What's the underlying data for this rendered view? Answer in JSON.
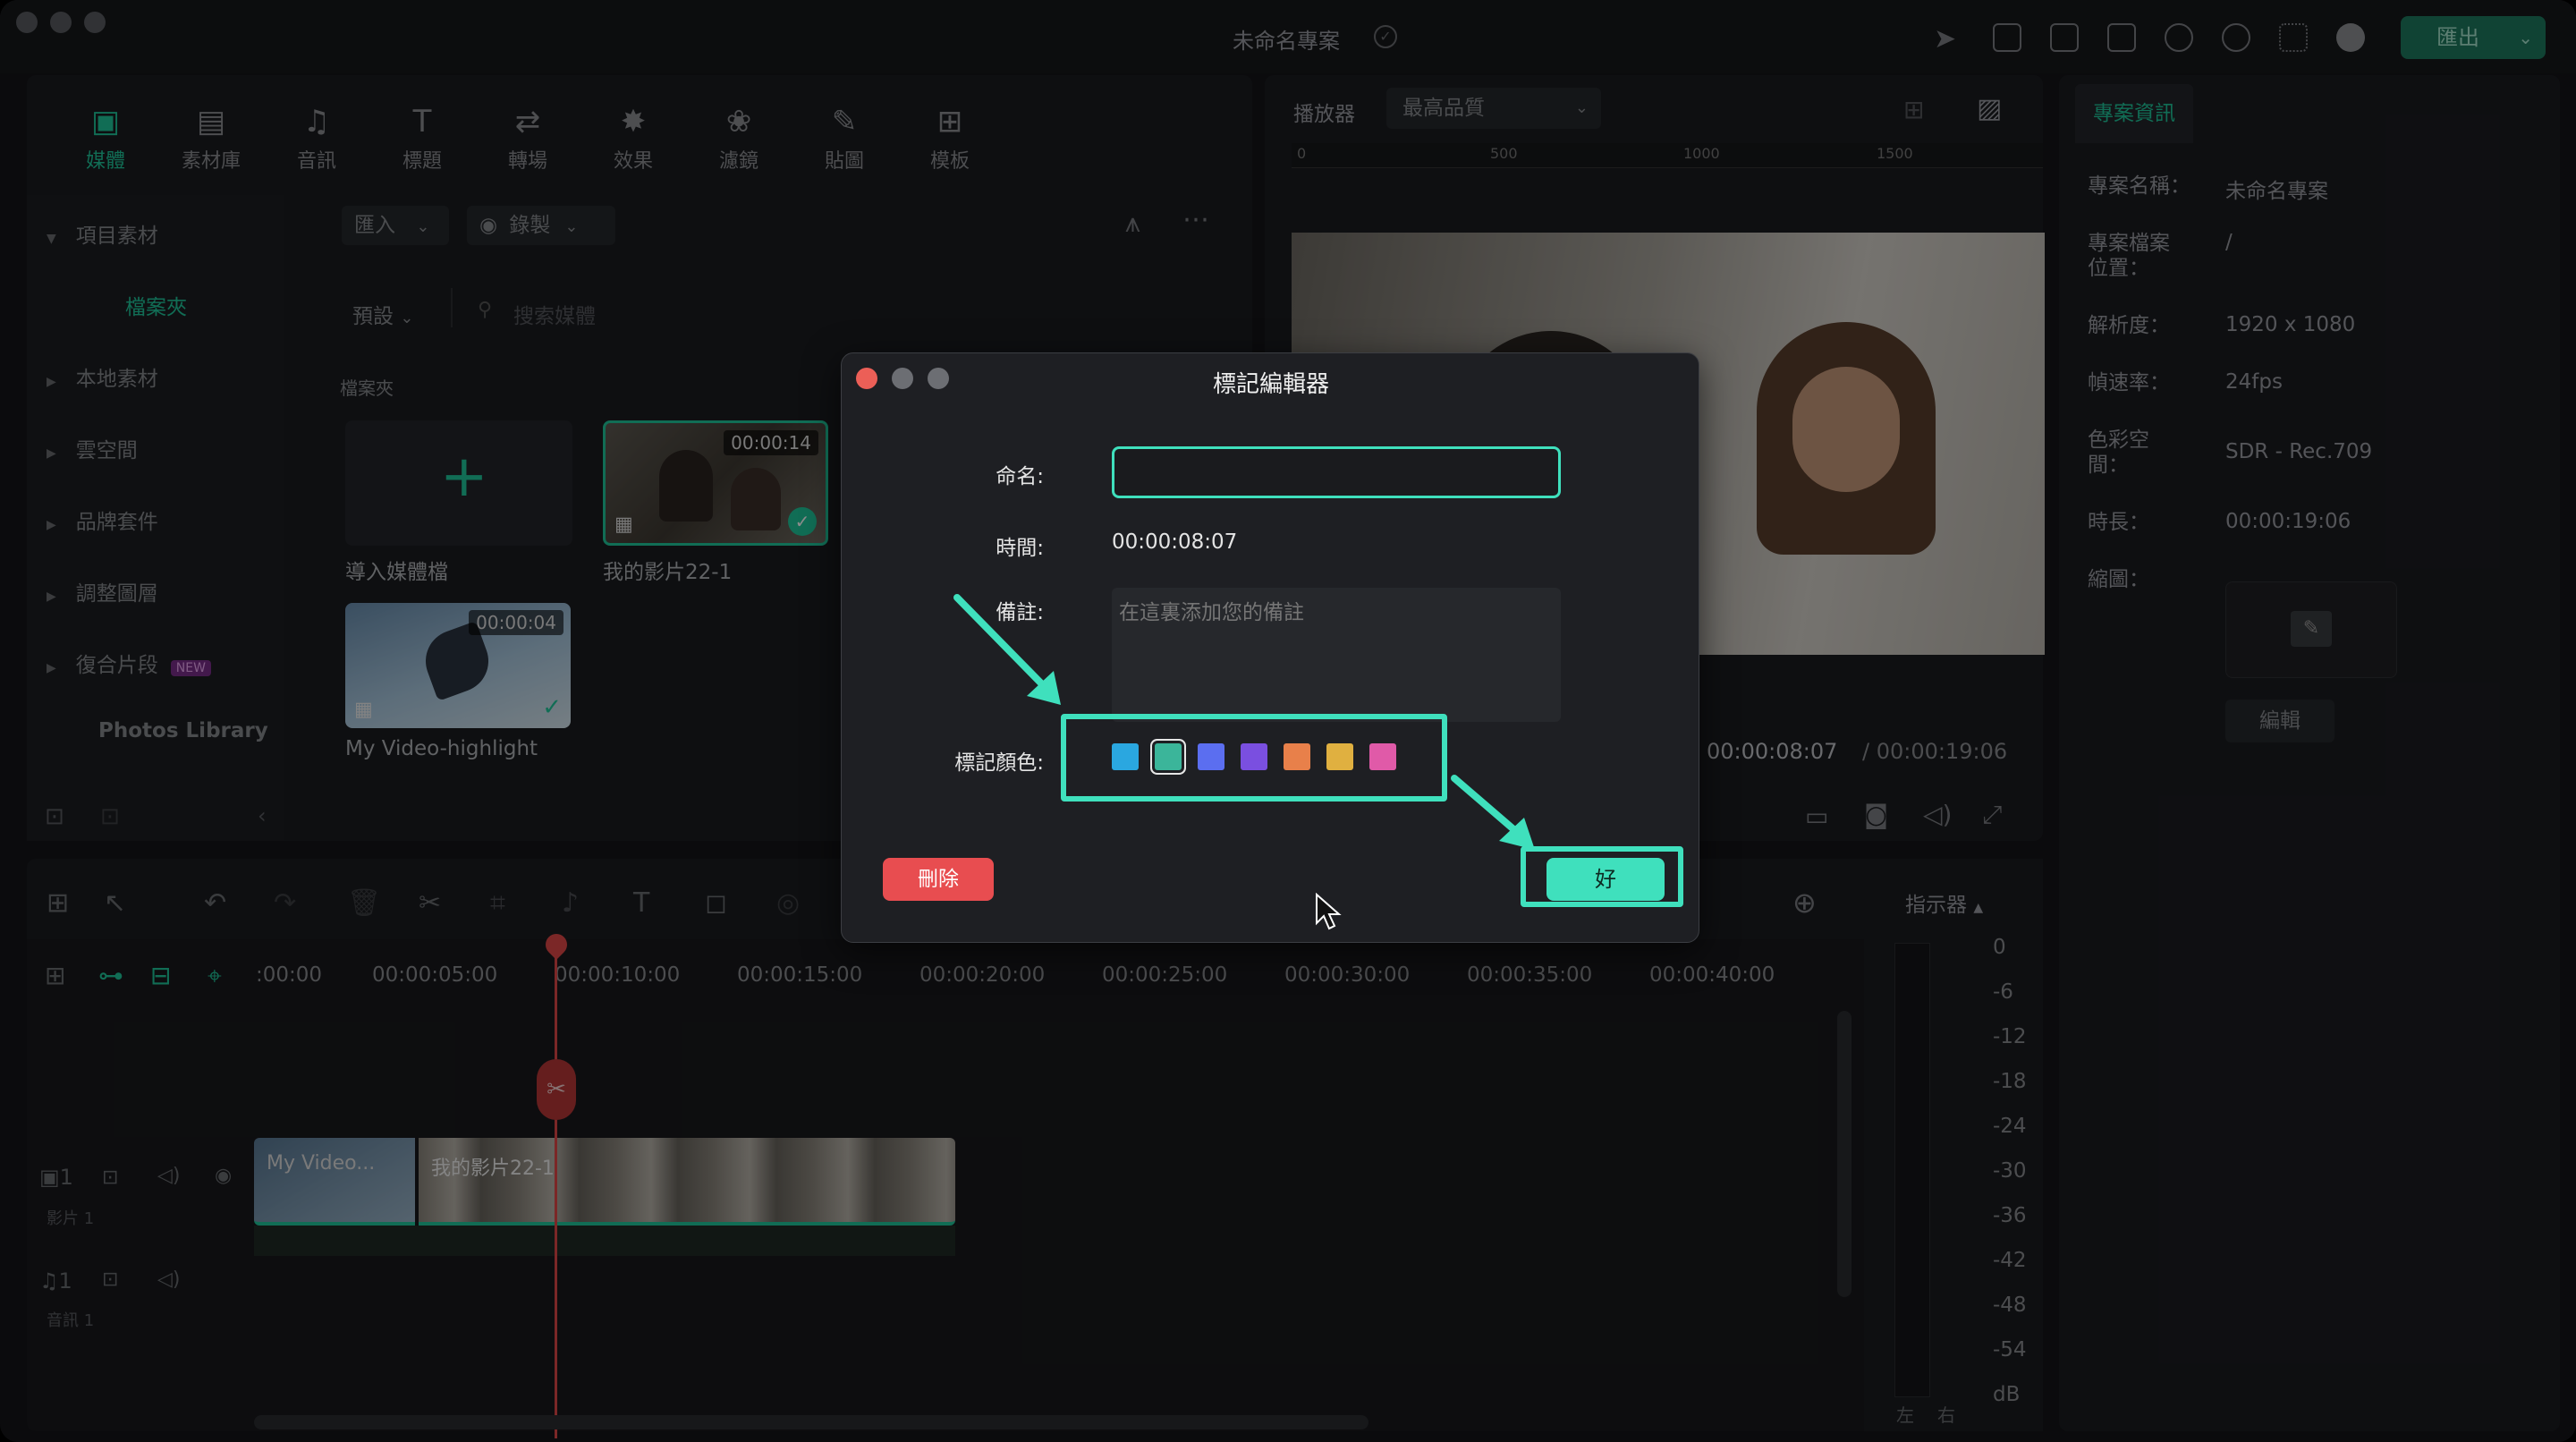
{
  "window": {
    "title": "未命名專案",
    "export_label": "匯出"
  },
  "media_tabs": [
    {
      "label": "媒體",
      "icon": "media-icon"
    },
    {
      "label": "素材庫",
      "icon": "stock-icon"
    },
    {
      "label": "音訊",
      "icon": "music-icon"
    },
    {
      "label": "標題",
      "icon": "title-icon"
    },
    {
      "label": "轉場",
      "icon": "transition-icon"
    },
    {
      "label": "效果",
      "icon": "effects-icon"
    },
    {
      "label": "濾鏡",
      "icon": "filters-icon"
    },
    {
      "label": "貼圖",
      "icon": "stickers-icon"
    },
    {
      "label": "模板",
      "icon": "templates-icon"
    }
  ],
  "sidebar": {
    "items": [
      {
        "label": "項目素材"
      },
      {
        "label": "檔案夾"
      },
      {
        "label": "本地素材"
      },
      {
        "label": "雲空間"
      },
      {
        "label": "品牌套件"
      },
      {
        "label": "調整圖層"
      },
      {
        "label": "復合片段",
        "badge": "NEW"
      },
      {
        "label": "Photos Library"
      }
    ]
  },
  "library": {
    "import_label": "匯入",
    "record_label": "錄製",
    "preset_label": "預設",
    "search_placeholder": "搜索媒體",
    "folder_label": "檔案夾",
    "import_media_label": "導入媒體檔",
    "clips": [
      {
        "name": "我的影片22-1",
        "duration": "00:00:14"
      },
      {
        "name": "My Video-highlight",
        "duration": "00:00:04"
      }
    ]
  },
  "player": {
    "label": "播放器",
    "quality": "最高品質",
    "ruler": [
      "0",
      "500",
      "1000",
      "1500"
    ],
    "current_time": "00:00:08:07",
    "total_time": "/ 00:00:19:06"
  },
  "project_info": {
    "tab": "專案資訊",
    "rows": [
      {
        "key": "專案名稱：",
        "value": "未命名專案"
      },
      {
        "key": "專案檔案位置：",
        "value": "/"
      },
      {
        "key": "解析度：",
        "value": "1920 x 1080"
      },
      {
        "key": "幀速率：",
        "value": "24fps"
      },
      {
        "key": "色彩空間：",
        "value": "SDR - Rec.709"
      },
      {
        "key": "時長：",
        "value": "00:00:19:06"
      },
      {
        "key": "縮圖：",
        "value": ""
      }
    ],
    "edit_label": "編輯"
  },
  "timeline": {
    "ticks": [
      ":00:00",
      "00:00:05:00",
      "00:00:10:00",
      "00:00:15:00",
      "00:00:20:00",
      "00:00:25:00",
      "00:00:30:00",
      "00:00:35:00",
      "00:00:40:00"
    ],
    "video_track": "影片 1",
    "audio_track": "音訊 1",
    "clip_a": "My Video...",
    "clip_b": "我的影片22-1",
    "meter_label": "指示器",
    "meter_scale": [
      "0",
      "-6",
      "-12",
      "-18",
      "-24",
      "-30",
      "-36",
      "-42",
      "-48",
      "-54",
      "dB"
    ],
    "left": "左",
    "right": "右"
  },
  "dialog": {
    "title": "標記編輯器",
    "name_label": "命名:",
    "name_value": "",
    "time_label": "時間:",
    "time_value": "00:00:08:07",
    "note_label": "備註:",
    "note_placeholder": "在這裏添加您的備註",
    "color_label": "標記顏色:",
    "colors": [
      "#2aa7e0",
      "#3bb59a",
      "#5b6ef0",
      "#7a4fe0",
      "#e8804a",
      "#e0b040",
      "#e05aa8"
    ],
    "delete_label": "刪除",
    "ok_label": "好",
    "accent": "#3fe0bd"
  }
}
